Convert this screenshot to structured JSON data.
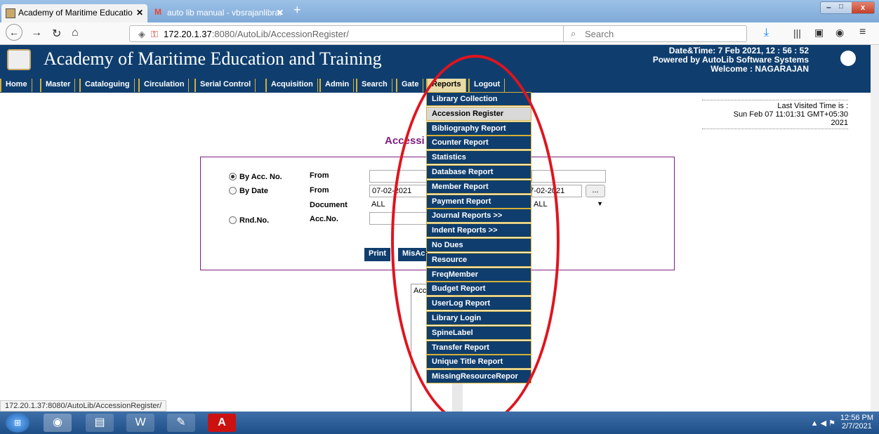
{
  "browser": {
    "tabs": [
      {
        "label": "Academy of Maritime Educatio",
        "active": true
      },
      {
        "label": "auto lib manual - vbsrajanlibrar",
        "active": false
      }
    ],
    "url_host": "172.20.1.37",
    "url_path": ":8080/AutoLib/AccessionRegister/",
    "search_placeholder": "Search",
    "status_url": "172.20.1.37:8080/AutoLib/AccessionRegister/"
  },
  "header": {
    "title": "Academy of Maritime Education and Training",
    "datetime": "Date&Time:  7 Feb 2021, 12 : 56 : 52",
    "powered": "Powered by AutoLib Software Systems",
    "welcome": "Welcome   :  NAGARAJAN"
  },
  "menu": [
    "Home",
    "Master",
    "Cataloguing",
    "Circulation",
    "Serial Control",
    "Acquisition",
    "Admin",
    "Search",
    "Gate",
    "Reports",
    "Logout"
  ],
  "last_visited": {
    "label": "Last Visited Time is :",
    "value1": "Sun Feb 07 11:01:31 GMT+05:30",
    "value2": "2021"
  },
  "page_heading": "Accessi",
  "form": {
    "opt_acc": "By Acc. No.",
    "opt_date": "By Date",
    "opt_rnd": "Rnd.No.",
    "from": "From",
    "document": "Document",
    "accno": "Acc.No.",
    "date_from": "07-02-2021",
    "date_to": "07-02-2021",
    "doc_value": "ALL",
    "doc_value2": "ALL",
    "print_label": "Print",
    "misacc_label": "MisAc",
    "listbox_text": "Acc",
    "dots": "..."
  },
  "reports_dropdown": [
    "Library Collection",
    "Accession Register",
    "Bibliography Report",
    "Counter Report",
    "Statistics",
    "Database Report",
    "Member Report",
    "Payment Report",
    "Journal Reports   >>",
    "Indent Reports   >>",
    "No Dues",
    "Resource",
    "FreqMember",
    "Budget Report",
    "UserLog Report",
    "Library Login",
    "SpineLabel",
    "Transfer Report",
    "Unique Title Report",
    "MissingResourceRepor"
  ],
  "taskbar": {
    "time": "12:56 PM",
    "date": "2/7/2021"
  }
}
